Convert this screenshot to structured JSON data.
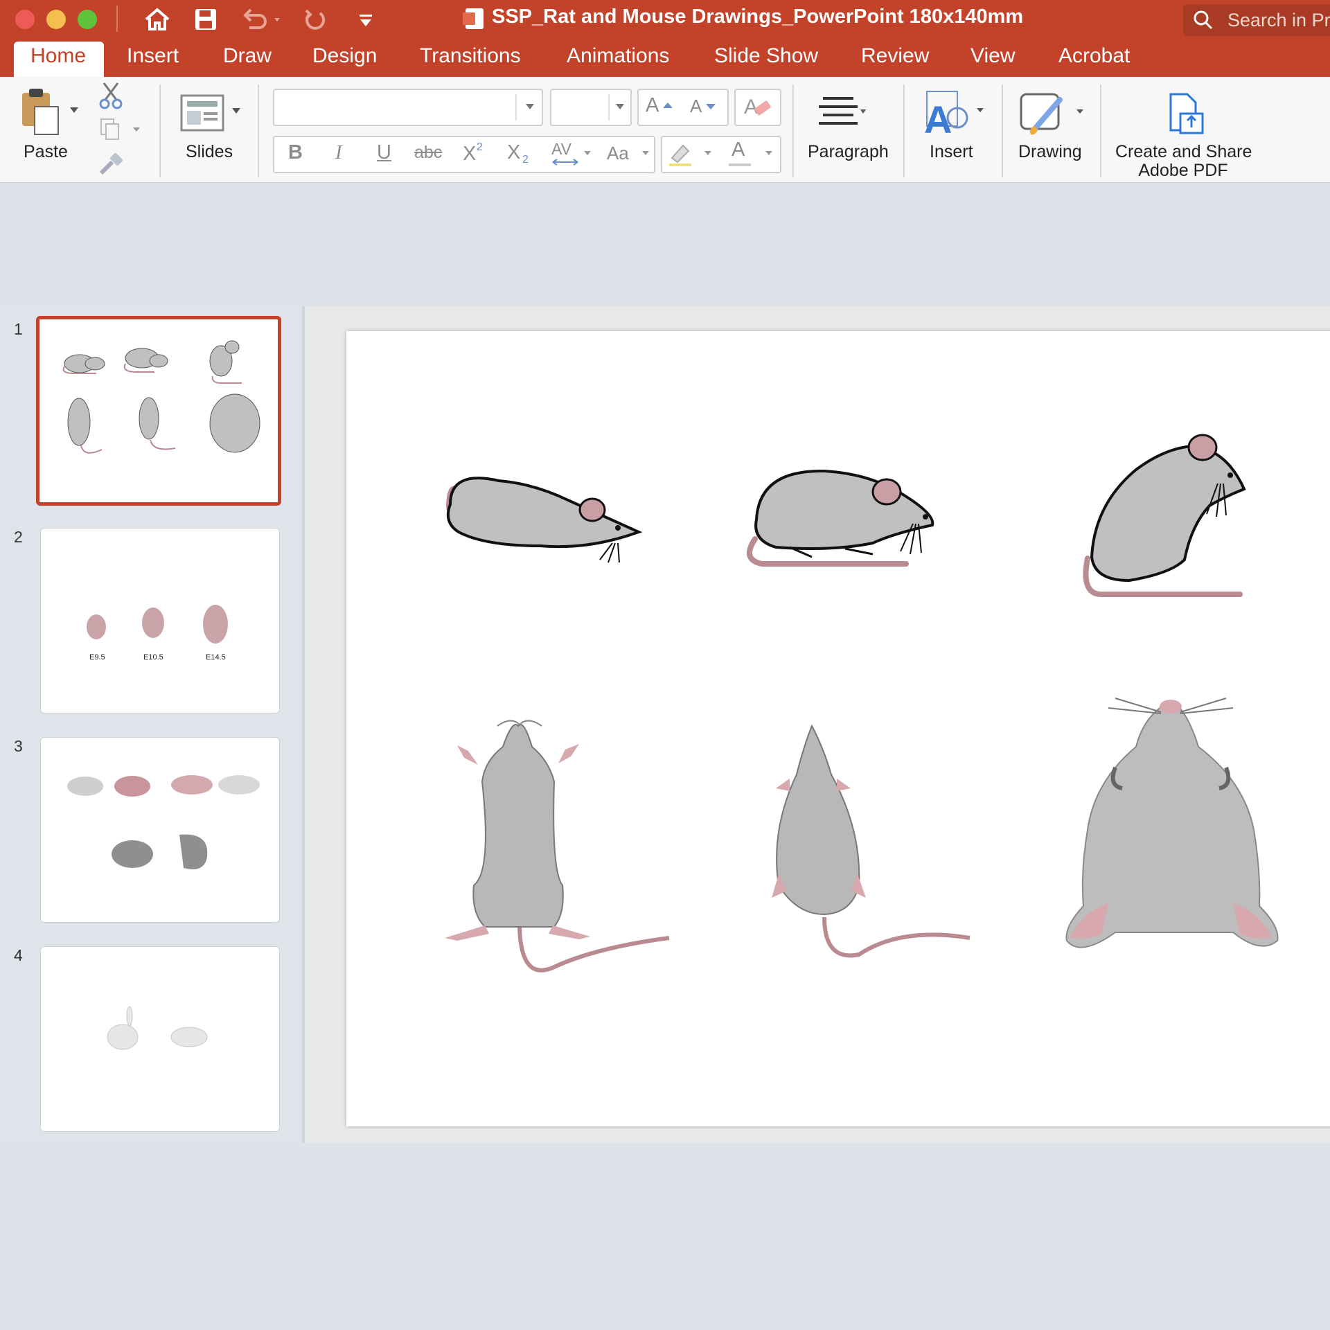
{
  "window": {
    "title": "SSP_Rat and Mouse Drawings_PowerPoint 180x140mm",
    "search_placeholder": "Search in Pr"
  },
  "tabs": [
    "Home",
    "Insert",
    "Draw",
    "Design",
    "Transitions",
    "Animations",
    "Slide Show",
    "Review",
    "View",
    "Acrobat"
  ],
  "ribbon": {
    "paste_label": "Paste",
    "slides_label": "Slides",
    "paragraph_label": "Paragraph",
    "insert_label": "Insert",
    "drawing_label": "Drawing",
    "pdf_label_line1": "Create and Share",
    "pdf_label_line2": "Adobe PDF",
    "font_name": "",
    "font_size": "",
    "bold": "B",
    "italic": "I",
    "underline": "U",
    "strike": "abc",
    "superscript": "X",
    "subscript": "X",
    "spacing": "AV",
    "change_case": "Aa",
    "font_color": "A",
    "grow_font": "A",
    "shrink_font": "A"
  },
  "slides": [
    {
      "number": "1",
      "selected": true
    },
    {
      "number": "2",
      "labels": [
        "E9.5",
        "E10.5",
        "E14.5"
      ]
    },
    {
      "number": "3"
    },
    {
      "number": "4"
    }
  ],
  "colors": {
    "accent": "#c2432a",
    "mouse_fill": "#c0c0c0",
    "tail": "#b98a90"
  }
}
